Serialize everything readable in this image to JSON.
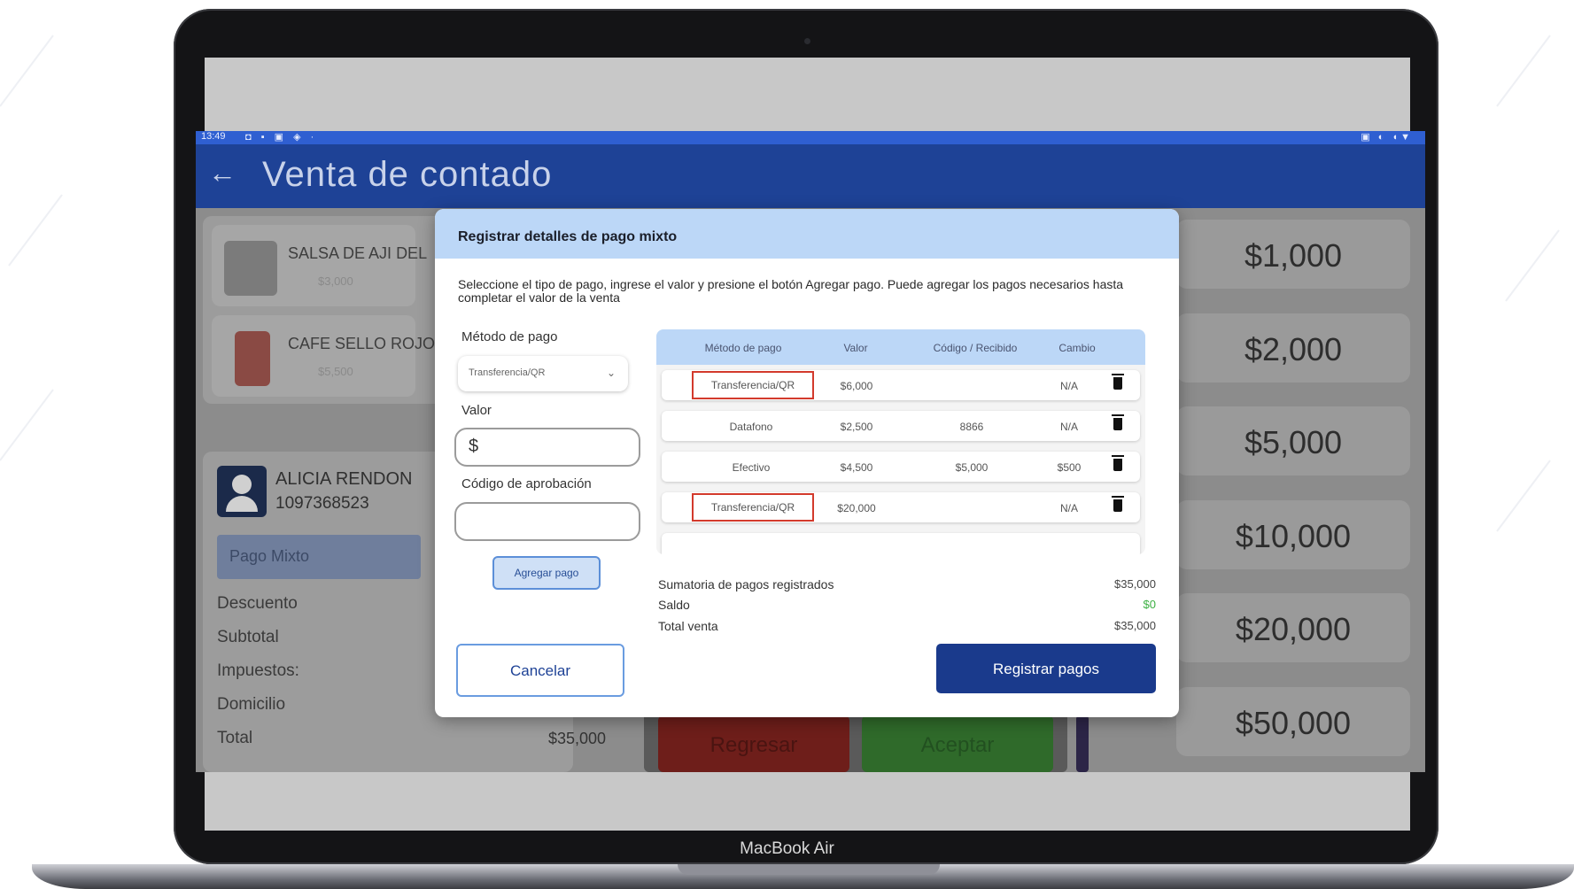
{
  "device": {
    "label": "MacBook Air"
  },
  "statusbar": {
    "time": "13:49",
    "left_icons": "◘ ▪ ▣ ◈ ·",
    "right_icons": "▣ ◐ ◖▼"
  },
  "appbar": {
    "back_icon": "←",
    "title": "Venta de contado"
  },
  "cart": {
    "items": [
      {
        "name": "SALSA DE AJI DEL",
        "price": "$3,000"
      },
      {
        "name": "CAFE SELLO ROJO",
        "price": "$5,500"
      }
    ]
  },
  "client": {
    "name": "ALICIA RENDON",
    "id": "1097368523"
  },
  "payment_mode": "Pago Mixto",
  "summary": {
    "labels": [
      "Descuento",
      "Subtotal",
      "Impuestos:",
      "Domicilio",
      "Total"
    ],
    "total_value": "$35,000"
  },
  "quick_amounts": [
    "$1,000",
    "$2,000",
    "$5,000",
    "$10,000",
    "$20,000",
    "$50,000"
  ],
  "bottom_buttons": {
    "back": "Regresar",
    "accept": "Aceptar"
  },
  "modal": {
    "title": "Registrar detalles de pago mixto",
    "description": "Seleccione el tipo de pago, ingrese el valor y presione el botón Agregar pago. Puede agregar los pagos necesarios hasta completar el valor de la venta",
    "method_label": "Método de pago",
    "method_value": "Transferencia/QR",
    "value_label": "Valor",
    "value_placeholder": "$",
    "approval_label": "Código de aprobación",
    "approval_value": "",
    "add_button": "Agregar pago",
    "cancel_button": "Cancelar",
    "submit_button": "Registrar pagos",
    "table": {
      "headers": [
        "Método de pago",
        "Valor",
        "Código / Recibido",
        "Cambio"
      ],
      "rows": [
        {
          "method": "Transferencia/QR",
          "value": "$6,000",
          "code": "",
          "change": "N/A",
          "highlight": true
        },
        {
          "method": "Datafono",
          "value": "$2,500",
          "code": "8866",
          "change": "N/A",
          "highlight": false
        },
        {
          "method": "Efectivo",
          "value": "$4,500",
          "code": "$5,000",
          "change": "$500",
          "highlight": false
        },
        {
          "method": "Transferencia/QR",
          "value": "$20,000",
          "code": "",
          "change": "N/A",
          "highlight": true
        }
      ]
    },
    "totals": {
      "registered_label": "Sumatoria de pagos registrados",
      "registered_value": "$35,000",
      "balance_label": "Saldo",
      "balance_value": "$0",
      "total_label": "Total venta",
      "total_value": "$35,000"
    },
    "colors": {
      "header_bg": "#bcd7f7",
      "primary": "#1a3a8c",
      "highlight_border": "#d33a2c",
      "balance_green": "#3cb043"
    }
  }
}
